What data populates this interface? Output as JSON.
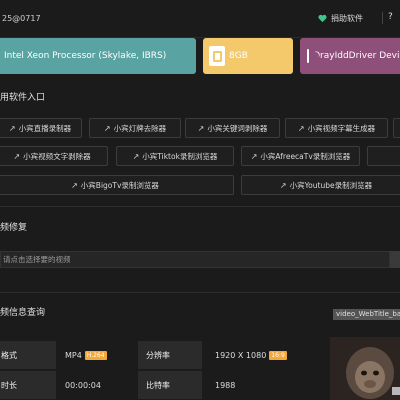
{
  "header": {
    "version": "25@0717",
    "donate_label": "捐助软件",
    "help_label": "?"
  },
  "hardware": {
    "cpu": "Intel Xeon Processor (Skylake, IBRS)",
    "ram": "8GB",
    "gpu": "OrayIddDriver Device"
  },
  "tools_section": {
    "title": "用软件入口",
    "buttons": [
      "小宾直播录制器",
      "小宾灯牌去除器",
      "小宾关键词剥除器",
      "小宾视频字幕生成器",
      "小宾视频文字剥除器",
      "小宾Tiktok录制浏览器",
      "小宾AfreecaTv录制浏览器",
      "小宾BigoTv录制浏览器",
      "小宾Youtube录制浏览器"
    ]
  },
  "repair_section": {
    "title": "频修复",
    "placeholder": "请点击选择要的视频"
  },
  "info_section": {
    "title": "频信息查询",
    "watermark_label": "video_WebTitle_ba",
    "rows": [
      {
        "k1": "格式",
        "v1": "MP4",
        "t1": "H.264",
        "k2": "分辨率",
        "v2": "1920 X 1080",
        "t2": "16:9"
      },
      {
        "k1": "时长",
        "v1": "00:00:04",
        "t1": "",
        "k2": "比特率",
        "v2": "1988",
        "t2": ""
      }
    ]
  },
  "colors": {
    "cpu_card": "#59a4a2",
    "ram_card": "#f4c96b",
    "gpu_card": "#8e4f7b",
    "tag": "#f4a73a",
    "donate_heart": "#3fc78b"
  }
}
